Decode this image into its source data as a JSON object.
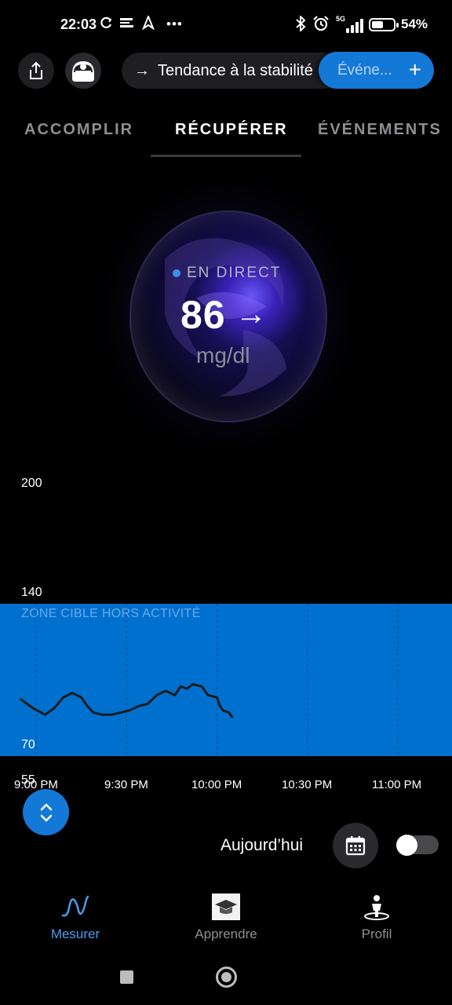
{
  "status_bar": {
    "time": "22:03",
    "network": "5G",
    "battery_percent": "54%",
    "battery_level": 0.54,
    "icons": [
      "sync-icon",
      "notification-icon",
      "location-icon",
      "more-icon",
      "bluetooth-icon",
      "alarm-icon",
      "signal-icon",
      "battery-icon"
    ],
    "more_glyph": "•••"
  },
  "header": {
    "trend_text": "Tendance à la stabilité",
    "trend_arrow": "→",
    "event_button_label": "Événe...",
    "event_button_plus": "+"
  },
  "tabs": [
    {
      "label": "ACCOMPLIR",
      "active": false
    },
    {
      "label": "RÉCUPÉRER",
      "active": true
    },
    {
      "label": "ÉVÉNEMENTS",
      "active": false
    }
  ],
  "reading": {
    "live_label": "EN DIRECT",
    "value": "86",
    "trend_arrow": "→",
    "unit": "mg/dl"
  },
  "chart_data": {
    "type": "line",
    "title": "",
    "xlabel": "",
    "ylabel": "",
    "y_tick_labels": [
      "200",
      "140",
      "70",
      "55"
    ],
    "x_tick_labels": [
      "9:00 PM",
      "9:30 PM",
      "10:00 PM",
      "10:30 PM",
      "11:00 PM"
    ],
    "target_zone": {
      "label": "ZONE CIBLE HORS ACTIVITÉ",
      "low": 70,
      "high": 140,
      "color": "#0070cf"
    },
    "series": [
      {
        "color": "#1c1c1e",
        "x": [
          "8:55 PM",
          "8:59 PM",
          "9:03 PM",
          "9:06 PM",
          "9:09 PM",
          "9:12 PM",
          "9:15 PM",
          "9:17 PM",
          "9:19 PM",
          "9:22 PM",
          "9:25 PM",
          "9:28 PM",
          "9:31 PM",
          "9:34 PM",
          "9:37 PM",
          "9:40 PM",
          "9:43 PM",
          "9:46 PM",
          "9:48 PM",
          "9:50 PM",
          "9:52 PM",
          "9:55 PM",
          "9:57 PM",
          "10:00 PM",
          "10:01 PM",
          "10:02 PM",
          "10:04 PM",
          "10:05 PM"
        ],
        "values": [
          96,
          92,
          89,
          92,
          97,
          99,
          97,
          93,
          90,
          89,
          89,
          90,
          91,
          93,
          94,
          98,
          100,
          98,
          102,
          101,
          103,
          102,
          98,
          97,
          93,
          91,
          90,
          88
        ]
      }
    ],
    "ylim": [
      55,
      210
    ],
    "grid": "vertical dashed lines at time ticks",
    "legend": "none"
  },
  "controls": {
    "today_label": "Aujourd’hui",
    "toggle_on": false
  },
  "bottom_nav": [
    {
      "label": "Mesurer",
      "icon": "wave-icon",
      "active": true
    },
    {
      "label": "Apprendre",
      "icon": "graduation-cap-icon",
      "active": false
    },
    {
      "label": "Profil",
      "icon": "person-icon",
      "active": false
    }
  ],
  "colors": {
    "accent": "#1478d6",
    "target_zone": "#0070cf",
    "active_nav": "#4a9cf0",
    "background": "#000000"
  }
}
